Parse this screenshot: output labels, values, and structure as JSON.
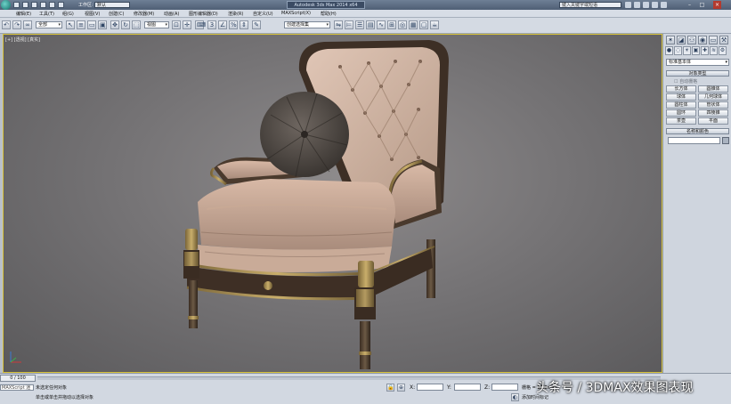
{
  "titlebar": {
    "workspace_label": "工作区:",
    "workspace_value": "默认",
    "window_title": "Autodesk 3ds Max 2014 x64",
    "help_search_placeholder": "键入关键字或短语"
  },
  "menu": [
    "编辑(E)",
    "工具(T)",
    "组(G)",
    "视图(V)",
    "创建(C)",
    "修改器(M)",
    "动画(A)",
    "图形编辑器(D)",
    "渲染(R)",
    "自定义(U)",
    "MAXScript(X)",
    "帮助(H)"
  ],
  "toolbar": {
    "selection_filter": "全部",
    "ref_coord": "视图",
    "named_selection": "创建选择集"
  },
  "viewport": {
    "label": "[+] [透视] [真实]"
  },
  "command_panel": {
    "category": "标准基本体",
    "object_type_header": "对象类型",
    "autogrid": "自动栅格",
    "buttons": [
      "长方体",
      "圆锥体",
      "球体",
      "几何球体",
      "圆柱体",
      "管状体",
      "圆环",
      "四棱锥",
      "茶壶",
      "平面"
    ],
    "name_color_header": "名称和颜色"
  },
  "bottom": {
    "time_slider": "0 / 100",
    "maxscript_label": "MAXScript 迷",
    "status_line1": "未选定任何对象",
    "status_line2": "单击或单击并拖动以选择对象",
    "x_label": "X:",
    "y_label": "Y:",
    "z_label": "Z:",
    "grid_label": "栅格 = 10.0mm",
    "add_time_tag": "添加时间标记"
  },
  "watermark": "头条号 / 3DMAX效果图表现",
  "colors": {
    "viewport_bg": "#787678",
    "viewport_border": "#d7c23a",
    "panel_bg": "#cfd5de"
  }
}
